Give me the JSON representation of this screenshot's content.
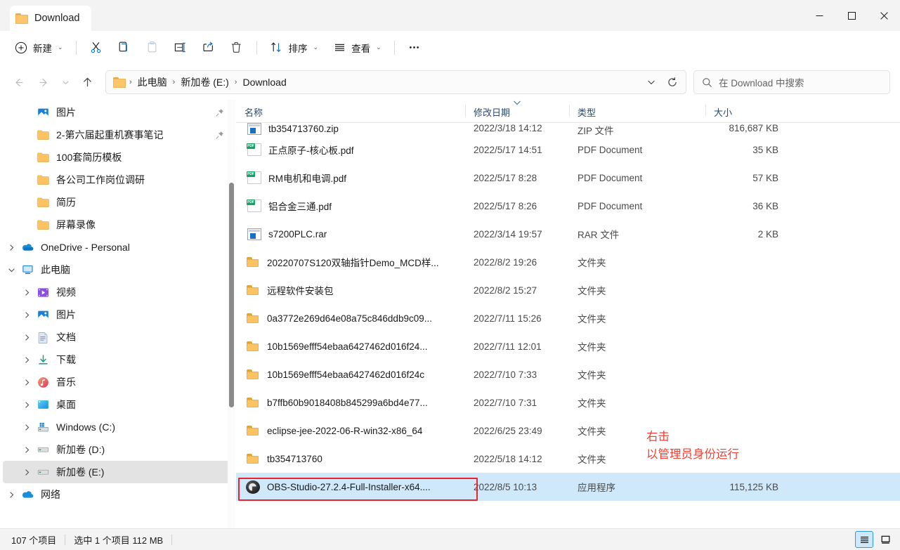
{
  "window": {
    "tab_title": "Download",
    "minimize_label": "最小化",
    "maximize_label": "最大化",
    "close_label": "关闭"
  },
  "toolbar": {
    "new_label": "新建",
    "cut_label": "剪切",
    "copy_label": "复制",
    "paste_label": "粘贴",
    "rename_label": "重命名",
    "share_label": "共享",
    "delete_label": "删除",
    "sort_label": "排序",
    "view_label": "查看",
    "more_label": "查看更多"
  },
  "address": {
    "back_label": "后退",
    "forward_label": "前进",
    "recent_label": "最近的位置",
    "up_label": "向上",
    "crumbs": [
      "此电脑",
      "新加卷 (E:)",
      "Download"
    ],
    "separator": "›",
    "refresh_label": "刷新",
    "dropdown_label": "以前的位置"
  },
  "search": {
    "placeholder": "在 Download 中搜索"
  },
  "sidebar": {
    "items": [
      {
        "label": "图片",
        "icon": "pictures-icon",
        "indent": 1,
        "expander": "",
        "pinned": true
      },
      {
        "label": "2-第六届起重机赛事笔记",
        "icon": "folder-icon",
        "indent": 1,
        "expander": "",
        "pinned": true
      },
      {
        "label": "100套简历模板",
        "icon": "folder-icon",
        "indent": 1,
        "expander": "",
        "pinned": false
      },
      {
        "label": "各公司工作岗位调研",
        "icon": "folder-icon",
        "indent": 1,
        "expander": "",
        "pinned": false
      },
      {
        "label": "简历",
        "icon": "folder-icon",
        "indent": 1,
        "expander": "",
        "pinned": false
      },
      {
        "label": "屏幕录像",
        "icon": "folder-icon",
        "indent": 1,
        "expander": "",
        "pinned": false
      },
      {
        "label": "OneDrive - Personal",
        "icon": "onedrive-icon",
        "indent": 0,
        "expander": "collapsed",
        "pinned": false
      },
      {
        "label": "此电脑",
        "icon": "this-pc-icon",
        "indent": 0,
        "expander": "expanded",
        "pinned": false
      },
      {
        "label": "视频",
        "icon": "videos-icon",
        "indent": 1,
        "expander": "collapsed",
        "pinned": false
      },
      {
        "label": "图片",
        "icon": "pictures-icon",
        "indent": 1,
        "expander": "collapsed",
        "pinned": false
      },
      {
        "label": "文档",
        "icon": "documents-icon",
        "indent": 1,
        "expander": "collapsed",
        "pinned": false
      },
      {
        "label": "下载",
        "icon": "downloads-icon",
        "indent": 1,
        "expander": "collapsed",
        "pinned": false
      },
      {
        "label": "音乐",
        "icon": "music-icon",
        "indent": 1,
        "expander": "collapsed",
        "pinned": false
      },
      {
        "label": "桌面",
        "icon": "desktop-icon",
        "indent": 1,
        "expander": "collapsed",
        "pinned": false
      },
      {
        "label": "Windows (C:)",
        "icon": "windows-drive-icon",
        "indent": 1,
        "expander": "collapsed",
        "pinned": false
      },
      {
        "label": "新加卷 (D:)",
        "icon": "drive-icon",
        "indent": 1,
        "expander": "collapsed",
        "pinned": false
      },
      {
        "label": "新加卷 (E:)",
        "icon": "drive-icon",
        "indent": 1,
        "expander": "collapsed",
        "pinned": false,
        "selected": true
      },
      {
        "label": "网络",
        "icon": "network-icon",
        "indent": 0,
        "expander": "collapsed",
        "pinned": false
      }
    ]
  },
  "filelist": {
    "columns": [
      {
        "key": "name",
        "label": "名称"
      },
      {
        "key": "date",
        "label": "修改日期",
        "sorted": "desc"
      },
      {
        "key": "type",
        "label": "类型"
      },
      {
        "key": "size",
        "label": "大小"
      }
    ],
    "rows": [
      {
        "name": "tb354713760.zip",
        "date": "2022/3/18 14:12",
        "type": "ZIP 文件",
        "size": "816,687 KB",
        "icon": "archive-icon",
        "clipped": true
      },
      {
        "name": "正点原子-核心板.pdf",
        "date": "2022/5/17 14:51",
        "type": "PDF Document",
        "size": "35 KB",
        "icon": "pdf-icon"
      },
      {
        "name": "RM电机和电调.pdf",
        "date": "2022/5/17 8:28",
        "type": "PDF Document",
        "size": "57 KB",
        "icon": "pdf-icon"
      },
      {
        "name": "铝合金三通.pdf",
        "date": "2022/5/17 8:26",
        "type": "PDF Document",
        "size": "36 KB",
        "icon": "pdf-icon"
      },
      {
        "name": "s7200PLC.rar",
        "date": "2022/3/14 19:57",
        "type": "RAR 文件",
        "size": "2 KB",
        "icon": "archive-icon"
      },
      {
        "name": "20220707S120双轴指针Demo_MCD样...",
        "date": "2022/8/2 19:26",
        "type": "文件夹",
        "size": "",
        "icon": "folder-icon"
      },
      {
        "name": "远程软件安装包",
        "date": "2022/8/2 15:27",
        "type": "文件夹",
        "size": "",
        "icon": "folder-icon"
      },
      {
        "name": "0a3772e269d64e08a75c846ddb9c09...",
        "date": "2022/7/11 15:26",
        "type": "文件夹",
        "size": "",
        "icon": "folder-icon"
      },
      {
        "name": "10b1569efff54ebaa6427462d016f24...",
        "date": "2022/7/11 12:01",
        "type": "文件夹",
        "size": "",
        "icon": "folder-icon"
      },
      {
        "name": "10b1569efff54ebaa6427462d016f24c",
        "date": "2022/7/10 7:33",
        "type": "文件夹",
        "size": "",
        "icon": "folder-icon"
      },
      {
        "name": "b7ffb60b9018408b845299a6bd4e77...",
        "date": "2022/7/10 7:31",
        "type": "文件夹",
        "size": "",
        "icon": "folder-icon"
      },
      {
        "name": "eclipse-jee-2022-06-R-win32-x86_64",
        "date": "2022/6/25 23:49",
        "type": "文件夹",
        "size": "",
        "icon": "folder-icon"
      },
      {
        "name": "tb354713760",
        "date": "2022/5/18 14:12",
        "type": "文件夹",
        "size": "",
        "icon": "folder-icon"
      },
      {
        "name": "OBS-Studio-27.2.4-Full-Installer-x64....",
        "date": "2022/8/5 10:13",
        "type": "应用程序",
        "size": "115,125 KB",
        "icon": "obs-icon",
        "selected": true
      }
    ]
  },
  "annotation": {
    "line1": "右击",
    "line2": "以管理员身份运行",
    "color": "#ef4136"
  },
  "statusbar": {
    "item_count": "107 个项目",
    "selection": "选中 1 个项目  112 MB",
    "details_view_label": "详细信息",
    "large_icons_view_label": "大图标"
  },
  "colors": {
    "accent": "#0f6cbd",
    "selection_bg": "#cfe8fa",
    "folder": "#fbc362",
    "annotation_red": "#ef4136"
  }
}
